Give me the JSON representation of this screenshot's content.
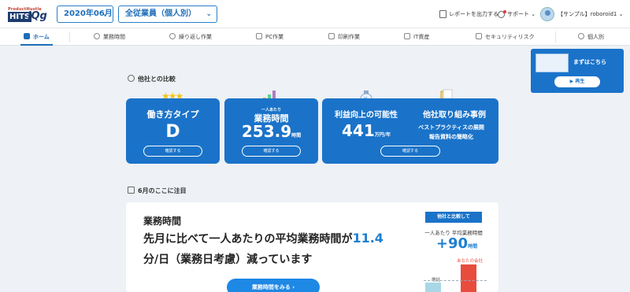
{
  "header": {
    "logo_brand": "ProductHustle",
    "logo_hits": "HITS",
    "logo_iqg": "lQg",
    "month_select": "2020年06月",
    "scope_select": "全従業員（個人別）",
    "report_link": "レポートを出力する",
    "support_link": "サポート",
    "user_name": "【サンプル】roboroid1"
  },
  "nav": {
    "items": [
      {
        "label": "ホーム"
      },
      {
        "label": "業務時間"
      },
      {
        "label": "繰り返し作業"
      },
      {
        "label": "PC作業"
      },
      {
        "label": "印刷作業"
      },
      {
        "label": "IT資産"
      },
      {
        "label": "セキュリティリスク"
      },
      {
        "label": "個人別"
      }
    ]
  },
  "promo": {
    "title": "まずはこちら",
    "play_label": "再生"
  },
  "compare_section": {
    "title": "他社との比較",
    "cards": [
      {
        "title": "働き方タイプ",
        "value": "D",
        "button": "確認する"
      },
      {
        "small": "一人あたり",
        "title": "業務時間",
        "value": "253.9",
        "unit": "時間",
        "button": "確認する"
      },
      {
        "title": "利益向上の可能性",
        "value": "441",
        "unit": "万円/年",
        "button": "確認する"
      },
      {
        "title": "他社取り組み事例",
        "line1": "ベストプラクティスの展開",
        "line2": "報告資料の簡略化"
      }
    ]
  },
  "focus_section": {
    "title": "6月のここに注目",
    "panel_title": "業務時間",
    "line1_pre": "先月に比べて一人あたりの平均業務時間が",
    "line1_value": "11.4",
    "line2": "分/日（業務日考慮）減っています",
    "button": "業務時間をみる",
    "compare_tag": "他社と比較して",
    "compare_label": "一人あたり 平均業務時間",
    "compare_value": "+90",
    "compare_unit": "時間",
    "bar_other_label": "他社",
    "bar_yours_label": "あなたの会社"
  },
  "colors": {
    "accent": "#1a73c9",
    "highlight": "#1e7fd0",
    "bar_other": "#a8d8e6",
    "bar_yours": "#e84c3d"
  }
}
